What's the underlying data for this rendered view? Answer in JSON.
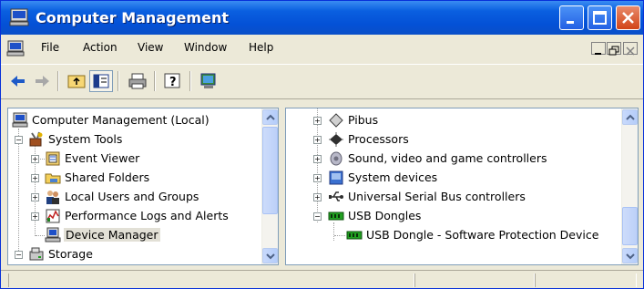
{
  "window": {
    "title": "Computer Management"
  },
  "menubar": {
    "items": [
      "File",
      "Action",
      "View",
      "Window",
      "Help"
    ]
  },
  "left_tree": {
    "items": [
      {
        "label": "Computer Management (Local)",
        "icon": "computer-management-icon"
      },
      {
        "label": "System Tools",
        "icon": "system-tools-icon"
      },
      {
        "label": "Event Viewer",
        "icon": "event-viewer-icon"
      },
      {
        "label": "Shared Folders",
        "icon": "shared-folders-icon"
      },
      {
        "label": "Local Users and Groups",
        "icon": "users-icon"
      },
      {
        "label": "Performance Logs and Alerts",
        "icon": "performance-icon"
      },
      {
        "label": "Device Manager",
        "icon": "device-manager-icon",
        "selected": true
      },
      {
        "label": "Storage",
        "icon": "storage-icon"
      }
    ]
  },
  "right_tree": {
    "items": [
      {
        "label": "Pibus",
        "icon": "pibus-icon"
      },
      {
        "label": "Processors",
        "icon": "processor-icon"
      },
      {
        "label": "Sound, video and game controllers",
        "icon": "speaker-icon"
      },
      {
        "label": "System devices",
        "icon": "system-devices-icon"
      },
      {
        "label": "Universal Serial Bus controllers",
        "icon": "usb-icon"
      },
      {
        "label": "USB Dongles",
        "icon": "dongle-icon"
      },
      {
        "label": "USB Dongle - Software Protection Device",
        "icon": "dongle-icon"
      }
    ]
  },
  "colors": {
    "titlebar": "#0a5fe0",
    "selection": "#e2e0d6",
    "close_button": "#d24417"
  }
}
